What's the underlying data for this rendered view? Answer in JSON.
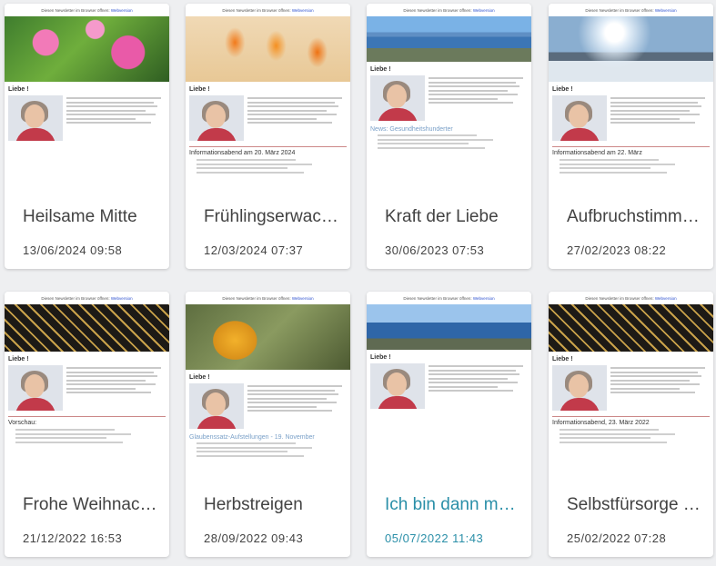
{
  "newsletter_header": {
    "prefix": "Diesen Newsletter im Browser öffnen:",
    "link": "Webversion"
  },
  "greeting": "Liebe !",
  "cards": [
    {
      "title": "Heilsame Mitte",
      "date": "13/06/2024 09:58",
      "hero": "pink-flowers"
    },
    {
      "title": "Frühlingserwac…",
      "date": "12/03/2024 07:37",
      "hero": "orange-tulips",
      "section": "Informationsabend am 20. März 2024"
    },
    {
      "title": "Kraft der Liebe",
      "date": "30/06/2023 07:53",
      "hero": "coast",
      "section": "News: Gesundheitshunderter"
    },
    {
      "title": "Aufbruchstimm…",
      "date": "27/02/2023 08:22",
      "hero": "snow-sun",
      "section": "Informationsabend am 22. März"
    },
    {
      "title": "Frohe Weihnac…",
      "date": "21/12/2022 16:53",
      "hero": "pattern",
      "section": "Vorschau:"
    },
    {
      "title": "Herbstreigen",
      "date": "28/09/2022 09:43",
      "hero": "mushroom",
      "section": "Glaubenssatz-Aufstellungen - 19. November"
    },
    {
      "title": "Ich bin dann ma…",
      "date": "05/07/2022 11:43",
      "hero": "sea",
      "active": true
    },
    {
      "title": "Selbstfürsorge …",
      "date": "25/02/2022 07:28",
      "hero": "pattern",
      "section": "Informationsabend, 23. März 2022"
    }
  ],
  "colors": {
    "accent": "#2a8fa8",
    "text": "#424242",
    "background": "#eeeff1"
  }
}
